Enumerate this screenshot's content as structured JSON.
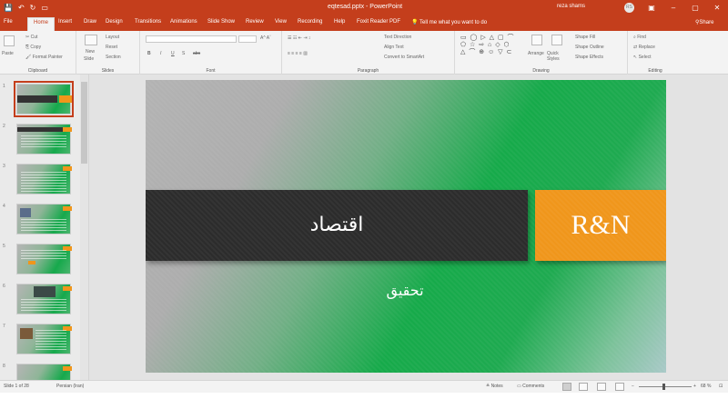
{
  "app": {
    "file_title": "eqtesad.pptx - PowerPoint",
    "account_name": "reza shams",
    "avatar_initials": "RS",
    "qat": {
      "save": "💾",
      "undo": "↶",
      "redo": "↻",
      "present": "▭"
    },
    "window": {
      "ribbon_options": "▣",
      "minimize": "–",
      "maximize": "▢",
      "close": "✕"
    }
  },
  "tabs": [
    {
      "label": "File"
    },
    {
      "label": "Home",
      "active": true
    },
    {
      "label": "Insert"
    },
    {
      "label": "Draw"
    },
    {
      "label": "Design"
    },
    {
      "label": "Transitions"
    },
    {
      "label": "Animations"
    },
    {
      "label": "Slide Show"
    },
    {
      "label": "Review"
    },
    {
      "label": "View"
    },
    {
      "label": "Recording"
    },
    {
      "label": "Help"
    },
    {
      "label": "Foxit Reader PDF"
    }
  ],
  "tell_me": "Tell me what you want to do",
  "share": "Share",
  "ribbon": {
    "clipboard": {
      "label": "Clipboard",
      "paste": "Paste",
      "cut": "Cut",
      "copy": "Copy",
      "format_painter": "Format Painter"
    },
    "slides": {
      "label": "Slides",
      "new_slide": "New",
      "new_slide_2": "Slide",
      "layout": "Layout",
      "reset": "Reset",
      "section": "Section"
    },
    "font": {
      "label": "Font",
      "bold": "B",
      "italic": "I",
      "underline": "U",
      "shadow": "S",
      "strike": "abc"
    },
    "paragraph": {
      "label": "Paragraph",
      "text_direction": "Text Direction",
      "align_text": "Align Text",
      "smartart": "Convert to SmartArt"
    },
    "drawing": {
      "label": "Drawing",
      "arrange": "Arrange",
      "quick_styles": "Quick Styles",
      "shape_fill": "Shape Fill",
      "shape_outline": "Shape Outline",
      "shape_effects": "Shape Effects"
    },
    "editing": {
      "label": "Editing",
      "find": "Find",
      "replace": "Replace",
      "select": "Select"
    }
  },
  "thumbnails": [
    "1",
    "2",
    "3",
    "4",
    "5",
    "6",
    "7",
    "8"
  ],
  "slide": {
    "title": "اقتصاد",
    "logo": "R&N",
    "subtitle": "تحقیق"
  },
  "status": {
    "slide_of": "Slide 1 of 28",
    "language": "Persian (Iran)",
    "notes": "Notes",
    "comments": "Comments",
    "zoom": "68 %"
  }
}
